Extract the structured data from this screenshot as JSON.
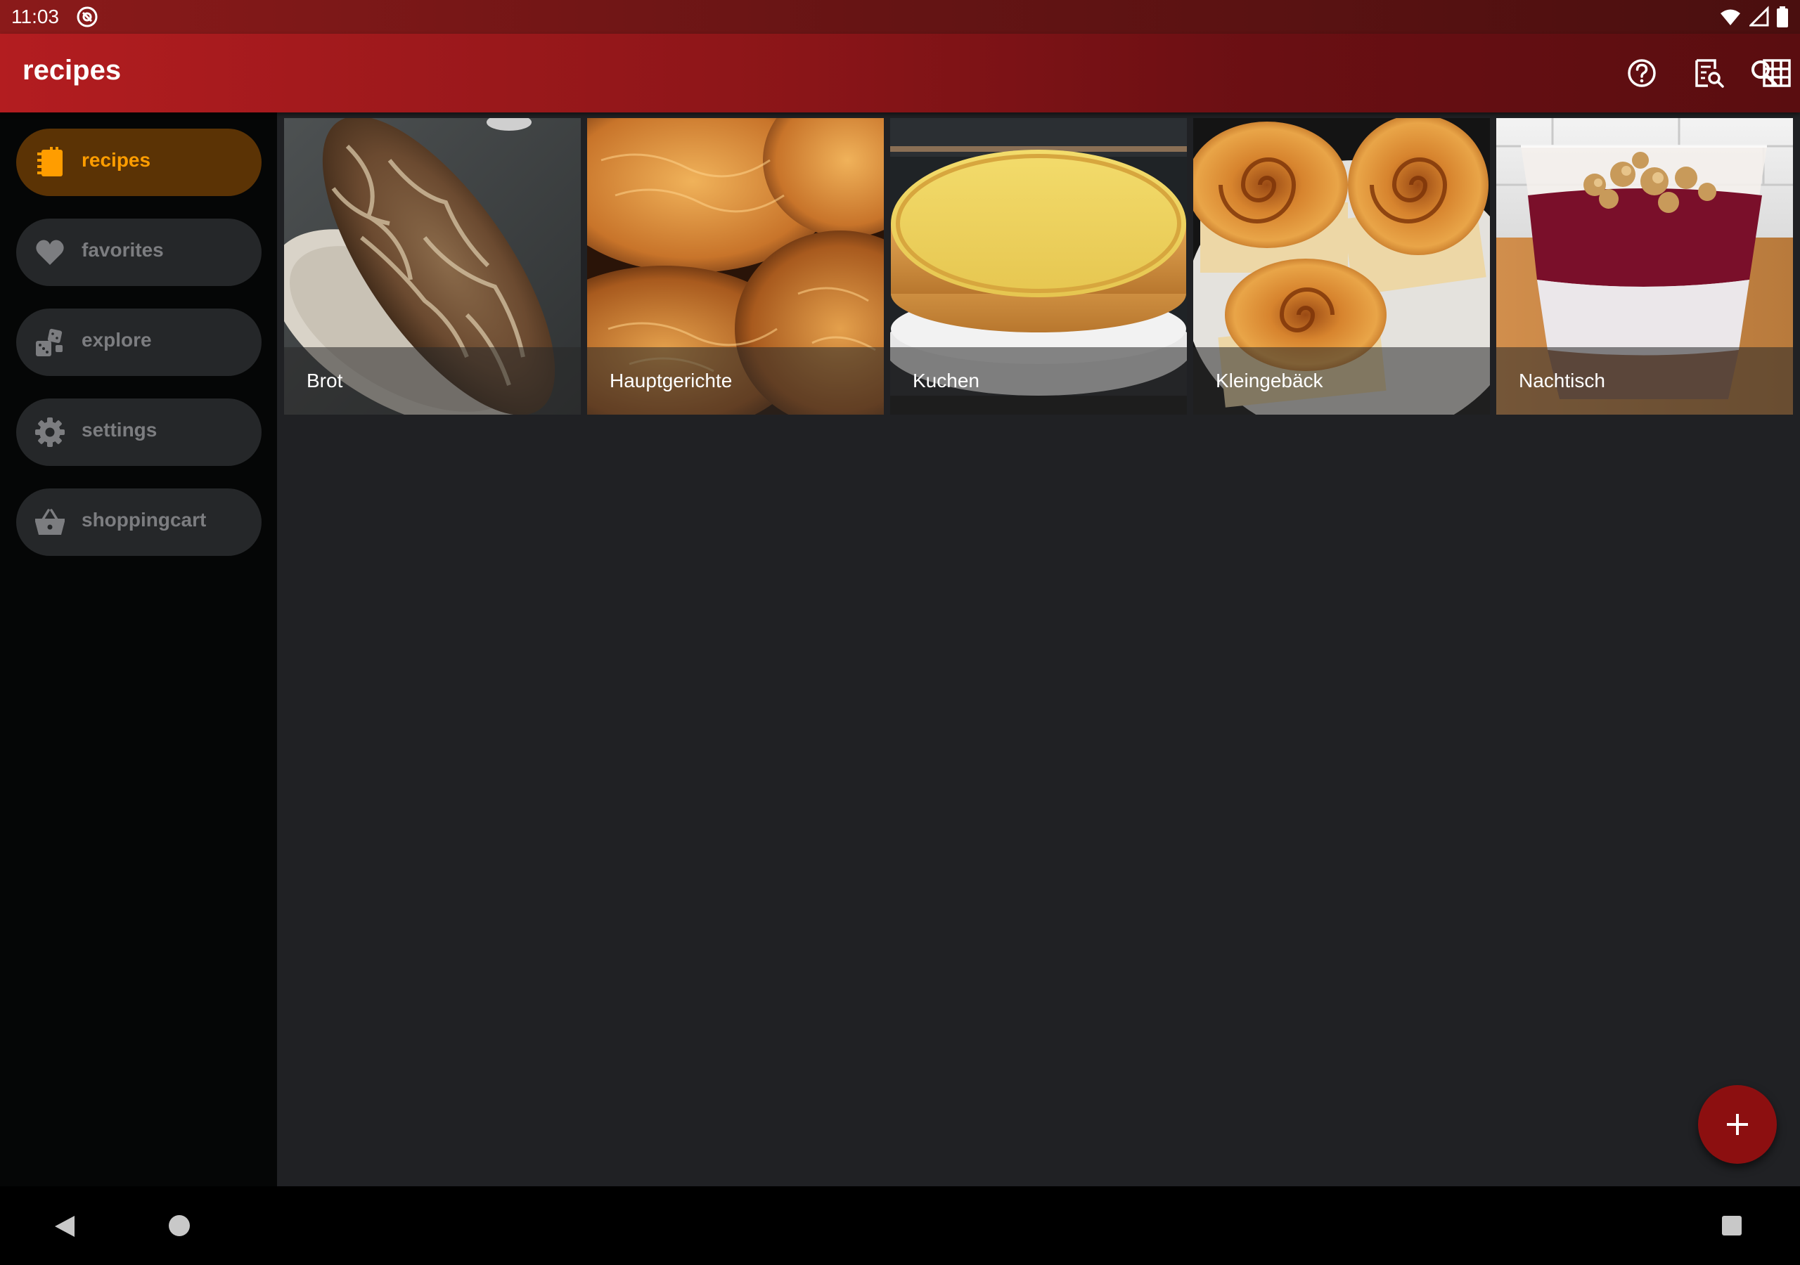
{
  "status_bar": {
    "time": "11:03"
  },
  "app_bar": {
    "title": "recipes",
    "actions": [
      "help-icon",
      "recipe-search-icon",
      "grid-view-icon",
      "search-icon"
    ]
  },
  "sidebar": {
    "items": [
      {
        "label": "recipes",
        "icon": "recipe-book-icon",
        "active": true
      },
      {
        "label": "favorites",
        "icon": "heart-icon",
        "active": false
      },
      {
        "label": "explore",
        "icon": "explore-icon",
        "active": false
      },
      {
        "label": "settings",
        "icon": "gear-icon",
        "active": false
      },
      {
        "label": "shoppingcart",
        "icon": "basket-icon",
        "active": false
      }
    ]
  },
  "categories": [
    {
      "label": "Brot"
    },
    {
      "label": "Hauptgerichte"
    },
    {
      "label": "Kuchen"
    },
    {
      "label": "Kleingebäck"
    },
    {
      "label": "Nachtisch"
    }
  ],
  "colors": {
    "accent": "#ff9d00",
    "app_bar": "#8a1518",
    "fab": "#8c0f10",
    "background": "#202124",
    "sidebar": "#050606"
  }
}
